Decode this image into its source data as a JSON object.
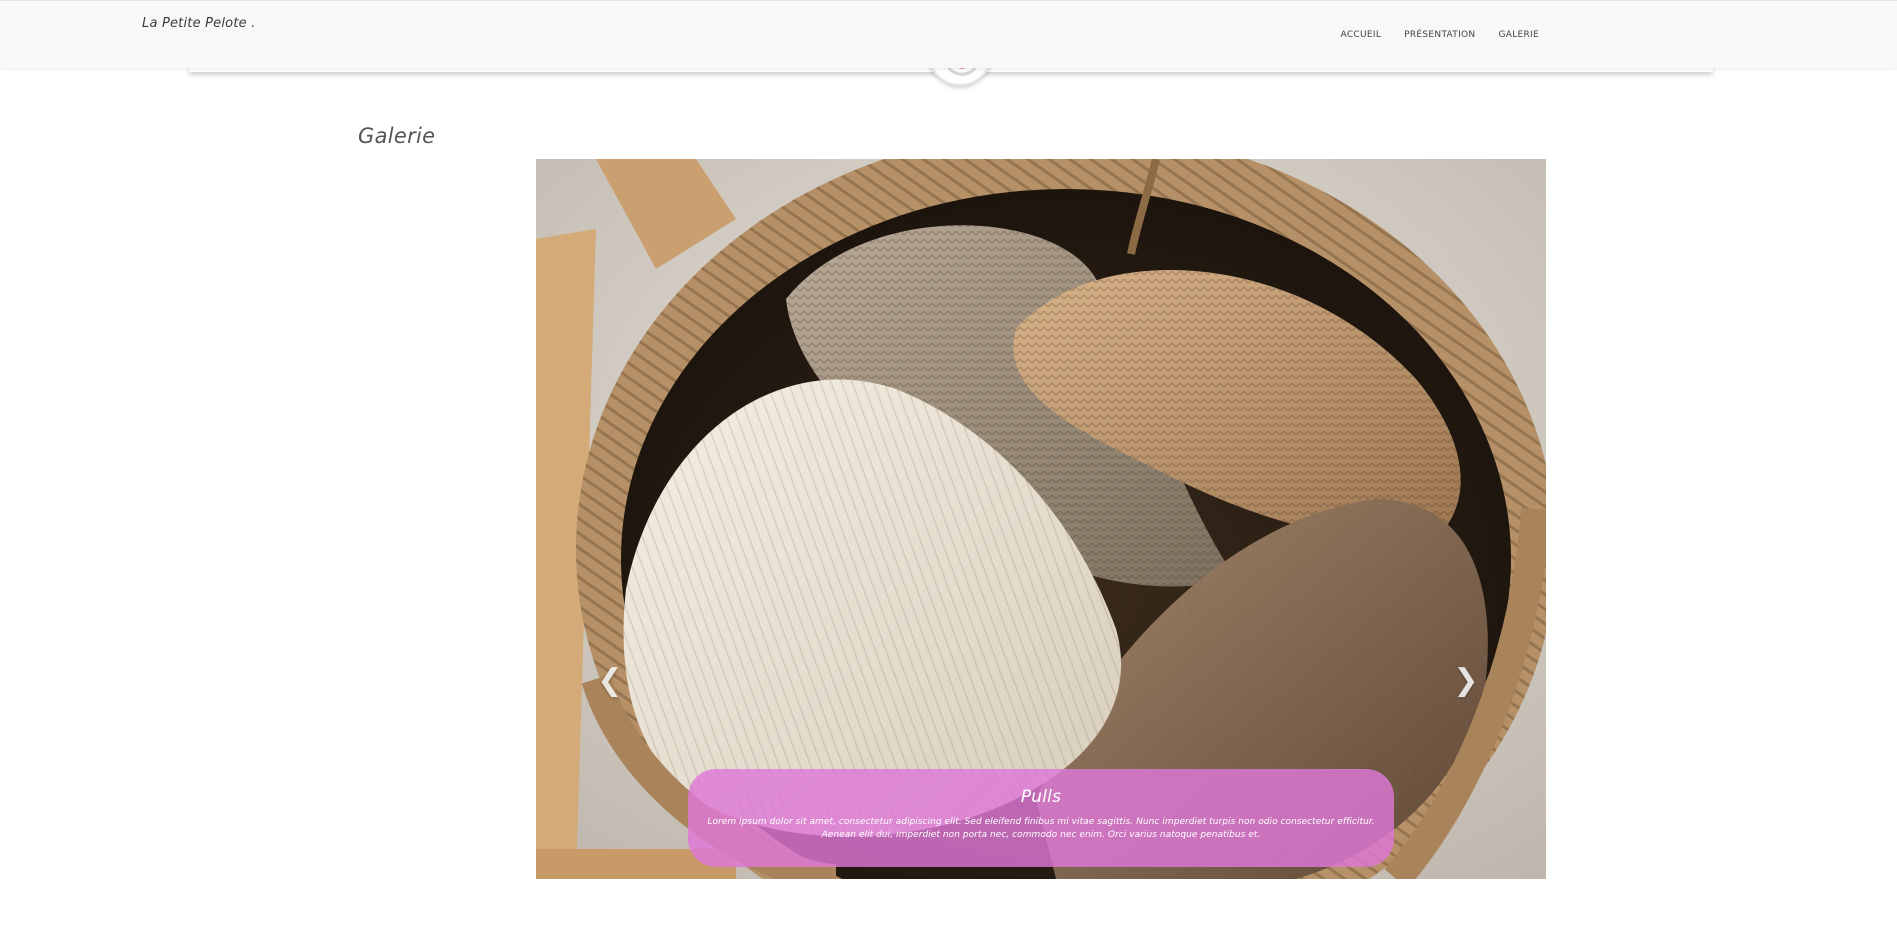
{
  "header": {
    "brand": "La Petite Pelote .",
    "nav": [
      {
        "label": "ACCUEIL"
      },
      {
        "label": "PRÉSENTATION"
      },
      {
        "label": "GALERIE"
      }
    ]
  },
  "gallery": {
    "title": "Galerie",
    "slide": {
      "caption_title": "Pulls",
      "caption_text": "Lorem ipsum dolor sit amet, consectetur adipiscing elit. Sed eleifend finibus mi vitae sagittis. Nunc imperdiet turpis non odio consectetur efficitur. Aenean elit dui, imperdiet non porta nec, commodo nec enim. Orci varius natoque penatibus et.",
      "image": "knitted-sweaters-basket-photo"
    },
    "prev_icon": "chevron-left-icon",
    "next_icon": "chevron-right-icon"
  },
  "colors": {
    "caption_bg": "#de78d7",
    "navbar_bg": "#f7f8fa"
  }
}
